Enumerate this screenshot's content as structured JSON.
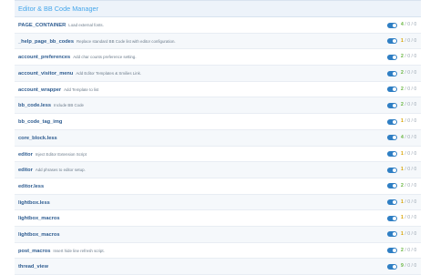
{
  "panel": {
    "title": "Editor & BB Code Manager"
  },
  "rows": [
    {
      "name": "PAGE_CONTAINER",
      "desc": "Load external fonts.",
      "count_active": "4",
      "count_rest": " / 0 / 0",
      "color": "g"
    },
    {
      "name": "_help_page_bb_codes",
      "desc": "Replace standard BB Code list with editor configuration.",
      "count_active": "1",
      "count_rest": " / 0 / 0",
      "color": "y"
    },
    {
      "name": "account_preferences",
      "desc": "Add char counts preference setting.",
      "count_active": "2",
      "count_rest": " / 0 / 0",
      "color": "g"
    },
    {
      "name": "account_visitor_menu",
      "desc": "Add Editor Templates & Smilies Link.",
      "count_active": "2",
      "count_rest": " / 0 / 0",
      "color": "g"
    },
    {
      "name": "account_wrapper",
      "desc": "Add Template to list",
      "count_active": "2",
      "count_rest": " / 0 / 0",
      "color": "g"
    },
    {
      "name": "bb_code.less",
      "desc": "Include BB Code",
      "count_active": "2",
      "count_rest": " / 0 / 0",
      "color": "g"
    },
    {
      "name": "bb_code_tag_img",
      "desc": "",
      "count_active": "1",
      "count_rest": " / 0 / 0",
      "color": "y"
    },
    {
      "name": "core_block.less",
      "desc": "",
      "count_active": "4",
      "count_rest": " / 0 / 0",
      "color": "g"
    },
    {
      "name": "editor",
      "desc": "Inject Editor Extension Script",
      "count_active": "1",
      "count_rest": " / 0 / 0",
      "color": "y"
    },
    {
      "name": "editor",
      "desc": "Add phrases to editor setup.",
      "count_active": "1",
      "count_rest": " / 0 / 0",
      "color": "y"
    },
    {
      "name": "editor.less",
      "desc": "",
      "count_active": "2",
      "count_rest": " / 0 / 0",
      "color": "g"
    },
    {
      "name": "lightbox.less",
      "desc": "",
      "count_active": "1",
      "count_rest": " / 0 / 0",
      "color": "y"
    },
    {
      "name": "lightbox_macros",
      "desc": "",
      "count_active": "1",
      "count_rest": " / 0 / 0",
      "color": "y"
    },
    {
      "name": "lightbox_macros",
      "desc": "",
      "count_active": "1",
      "count_rest": " / 0 / 0",
      "color": "y"
    },
    {
      "name": "post_macros",
      "desc": "Insert hide line refresh script.",
      "count_active": "2",
      "count_rest": " / 0 / 0",
      "color": "g"
    },
    {
      "name": "thread_view",
      "desc": "",
      "count_active": "9",
      "count_rest": " / 0 / 0",
      "color": "g"
    }
  ],
  "colors": {
    "accent": "#47a7eb",
    "link": "#2f5d91",
    "toggle_on": "#2f7fc4",
    "count_green": "#63b33a",
    "count_yellow": "#d7a300"
  }
}
